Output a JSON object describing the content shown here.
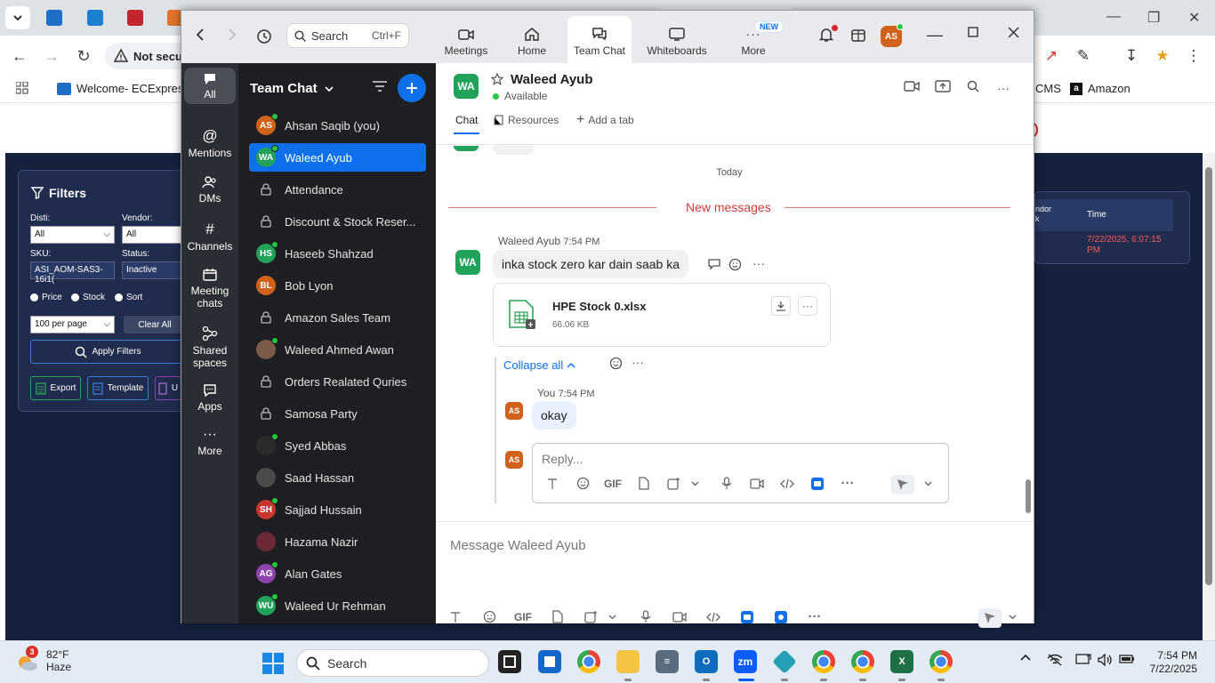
{
  "browser": {
    "address_text": "Not secur",
    "bookmarks": [
      {
        "label": "Welcome- ECExpres"
      },
      {
        "label": "CMS"
      },
      {
        "label": "Amazon"
      }
    ]
  },
  "filters_panel": {
    "title": "Filters",
    "disti_label": "Disti:",
    "disti_value": "All",
    "vendor_label": "Vendor:",
    "vendor_value": "All",
    "sku_label": "SKU:",
    "sku_value": "ASI_AOM-SAS3-16i1(",
    "status_label": "Status:",
    "status_value": "Inactive",
    "sort_options": [
      "Price",
      "Stock",
      "Sort"
    ],
    "per_page": "100 per page",
    "clear_all": "Clear All",
    "apply": "Apply Filters",
    "export": "Export",
    "template": "Template",
    "truncated": "U"
  },
  "right_table": {
    "col1": "ndor\nk",
    "col2": "Time",
    "time_value": "7/22/2025, 6:07:15 PM"
  },
  "zoom": {
    "search_placeholder": "Search",
    "search_shortcut": "Ctrl+F",
    "tabs": [
      {
        "label": "Meetings",
        "icon": "video-icon"
      },
      {
        "label": "Home",
        "icon": "home-icon"
      },
      {
        "label": "Team Chat",
        "icon": "chat-icon",
        "active": true
      },
      {
        "label": "Whiteboards",
        "icon": "whiteboard-icon"
      },
      {
        "label": "More",
        "icon": "more-icon"
      }
    ],
    "new_badge": "NEW",
    "profile_initials": "AS",
    "rail": [
      {
        "label": "All",
        "icon": "chat-bubble-icon",
        "active": true
      },
      {
        "label": "Mentions",
        "icon": "at-icon"
      },
      {
        "label": "DMs",
        "icon": "people-icon"
      },
      {
        "label": "Channels",
        "icon": "hash-icon"
      },
      {
        "label": "Meeting chats",
        "icon": "calendar-icon"
      },
      {
        "label": "Shared spaces",
        "icon": "share-icon"
      },
      {
        "label": "Apps",
        "icon": "apps-icon"
      },
      {
        "label": "More",
        "icon": "more-icon"
      }
    ],
    "chat_list_title": "Team Chat",
    "chats": [
      {
        "name": "Ahsan Saqib (you)",
        "initials": "AS",
        "color": "#d0621b",
        "online": true,
        "type": "person"
      },
      {
        "name": "Waleed Ayub",
        "initials": "WA",
        "color": "#20a25a",
        "online": true,
        "type": "person",
        "selected": true
      },
      {
        "name": "Attendance",
        "type": "channel"
      },
      {
        "name": "Discount & Stock Reser...",
        "type": "channel"
      },
      {
        "name": "Haseeb Shahzad",
        "initials": "HS",
        "color": "#20a25a",
        "online": true,
        "type": "person"
      },
      {
        "name": "Bob Lyon",
        "initials": "BL",
        "color": "#d0621b",
        "online": false,
        "type": "person"
      },
      {
        "name": "Amazon Sales Team",
        "type": "channel"
      },
      {
        "name": "Waleed Ahmed Awan",
        "initials": "",
        "color": "#7a5a48",
        "online": true,
        "type": "photo"
      },
      {
        "name": "Orders Realated Quries",
        "type": "channel"
      },
      {
        "name": "Samosa Party",
        "type": "channel"
      },
      {
        "name": "Syed Abbas",
        "initials": "",
        "color": "#2b2b2b",
        "online": true,
        "type": "photo"
      },
      {
        "name": "Saad Hassan",
        "initials": "",
        "color": "#4a4a4a",
        "online": false,
        "type": "photo"
      },
      {
        "name": "Sajjad Hussain",
        "initials": "SH",
        "color": "#c8372d",
        "online": true,
        "type": "person"
      },
      {
        "name": "Hazama Nazir",
        "initials": "",
        "color": "#6b2836",
        "online": false,
        "type": "photo"
      },
      {
        "name": "Alan Gates",
        "initials": "AG",
        "color": "#8e44ad",
        "online": true,
        "type": "person"
      },
      {
        "name": "Waleed Ur Rehman",
        "initials": "WU",
        "color": "#20a25a",
        "online": true,
        "type": "person"
      }
    ],
    "conversation": {
      "name": "Waleed Ayub",
      "initials": "WA",
      "status": "Available",
      "tabs": [
        "Chat",
        "Resources",
        "Add a tab"
      ],
      "day_label": "Today",
      "new_messages": "New messages",
      "message": {
        "sender": "Waleed Ayub",
        "time": "7:54 PM",
        "text": "inka stock zero kar dain saab ka"
      },
      "file": {
        "name": "HPE Stock 0.xlsx",
        "size": "66.06 KB"
      },
      "collapse_label": "Collapse all",
      "reply": {
        "sender": "You",
        "time": "7:54 PM",
        "text": "okay",
        "initials": "AS"
      },
      "reply_placeholder": "Reply...",
      "composer_placeholder": "Message Waleed Ayub",
      "gif_label": "GIF"
    }
  },
  "taskbar": {
    "weather_temp": "82°F",
    "weather_desc": "Haze",
    "weather_badge": "3",
    "search": "Search",
    "time": "7:54 PM",
    "date": "7/22/2025",
    "zoom_app_label": "zm"
  }
}
